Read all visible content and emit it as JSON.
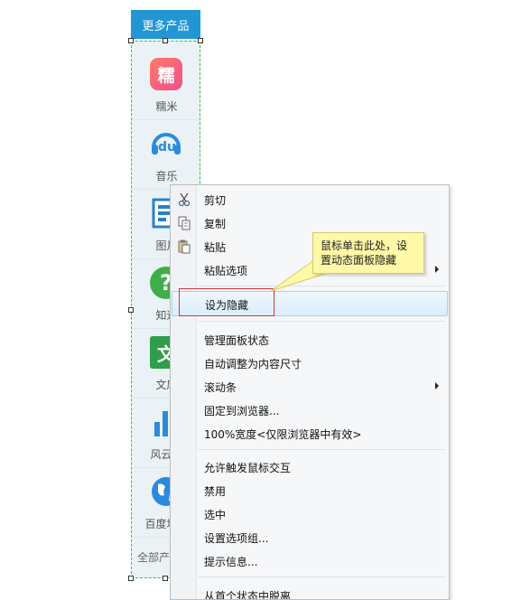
{
  "panel": {
    "header": "更多产品",
    "products": [
      {
        "label": "糯米",
        "icon": "nuomi-icon"
      },
      {
        "label": "音乐",
        "icon": "music-icon"
      },
      {
        "label": "图片",
        "icon": "image-icon"
      },
      {
        "label": "知道",
        "icon": "question-icon"
      },
      {
        "label": "文库",
        "icon": "wenku-icon"
      },
      {
        "label": "风云榜",
        "icon": "bar-chart-icon"
      },
      {
        "label": "百度地图",
        "icon": "globe-icon"
      }
    ],
    "all_products": "全部产品",
    "nuomi_glyph": "糯",
    "music_glyph": "du",
    "question_glyph": "?",
    "wenku_glyph": "文"
  },
  "menu": {
    "items": [
      {
        "label": "剪切",
        "icon": "scissors-icon"
      },
      {
        "label": "复制",
        "icon": "copy-icon"
      },
      {
        "label": "粘贴",
        "icon": "paste-icon"
      },
      {
        "label": "粘贴选项",
        "submenu": true
      },
      {
        "label": "设为隐藏",
        "highlighted": true
      },
      {
        "label": "管理面板状态"
      },
      {
        "label": "自动调整为内容尺寸"
      },
      {
        "label": "滚动条",
        "submenu": true
      },
      {
        "label": "固定到浏览器..."
      },
      {
        "label": "100%宽度<仅限浏览器中有效>"
      },
      {
        "label": "允许触发鼠标交互"
      },
      {
        "label": "禁用"
      },
      {
        "label": "选中"
      },
      {
        "label": "设置选项组..."
      },
      {
        "label": "提示信息..."
      },
      {
        "label": "从首个状态中脱离"
      }
    ]
  },
  "callout": {
    "line1": "鼠标单击此处，设",
    "line2": "置动态面板隐藏"
  },
  "colors": {
    "header_bg": "#2196d3",
    "panel_border": "#34c24a",
    "highlight_box": "#d9333a",
    "note_bg": "#fff8a6"
  }
}
